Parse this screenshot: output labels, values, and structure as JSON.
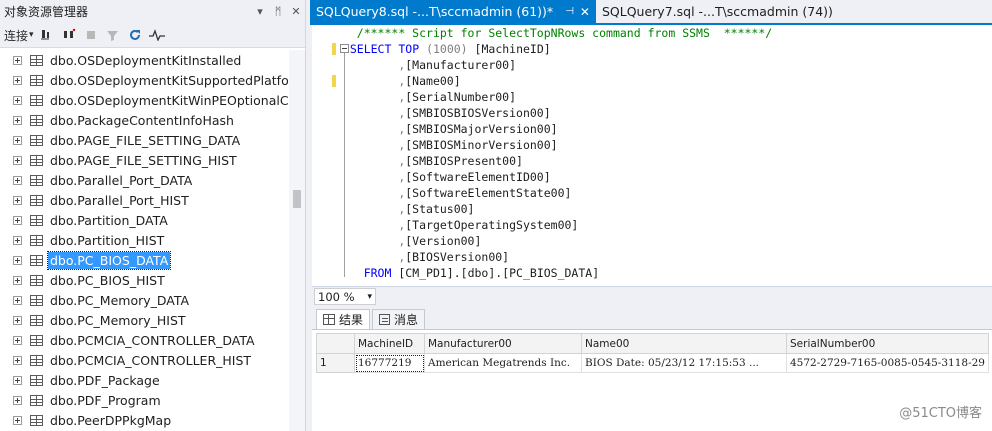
{
  "object_explorer": {
    "title": "对象资源管理器",
    "title_icons": [
      "▾",
      "ᛗ",
      "✕"
    ],
    "toolbar": {
      "connect_label": "连接",
      "connect_arrow": "▾"
    },
    "items": [
      {
        "label": "dbo.OSDeploymentKitInstalled",
        "selected": false
      },
      {
        "label": "dbo.OSDeploymentKitSupportedPlatform",
        "selected": false
      },
      {
        "label": "dbo.OSDeploymentKitWinPEOptionalCor",
        "selected": false
      },
      {
        "label": "dbo.PackageContentInfoHash",
        "selected": false
      },
      {
        "label": "dbo.PAGE_FILE_SETTING_DATA",
        "selected": false
      },
      {
        "label": "dbo.PAGE_FILE_SETTING_HIST",
        "selected": false
      },
      {
        "label": "dbo.Parallel_Port_DATA",
        "selected": false
      },
      {
        "label": "dbo.Parallel_Port_HIST",
        "selected": false
      },
      {
        "label": "dbo.Partition_DATA",
        "selected": false
      },
      {
        "label": "dbo.Partition_HIST",
        "selected": false
      },
      {
        "label": "dbo.PC_BIOS_DATA",
        "selected": true
      },
      {
        "label": "dbo.PC_BIOS_HIST",
        "selected": false
      },
      {
        "label": "dbo.PC_Memory_DATA",
        "selected": false
      },
      {
        "label": "dbo.PC_Memory_HIST",
        "selected": false
      },
      {
        "label": "dbo.PCMCIA_CONTROLLER_DATA",
        "selected": false
      },
      {
        "label": "dbo.PCMCIA_CONTROLLER_HIST",
        "selected": false
      },
      {
        "label": "dbo.PDF_Package",
        "selected": false
      },
      {
        "label": "dbo.PDF_Program",
        "selected": false
      },
      {
        "label": "dbo.PeerDPPkgMap",
        "selected": false
      }
    ]
  },
  "tabs": [
    {
      "label": "SQLQuery8.sql -...T\\sccmadmin (61))*",
      "active": true,
      "pin": "⊣",
      "close": "✕"
    },
    {
      "label": "SQLQuery7.sql -...T\\sccmadmin (74))",
      "active": false
    }
  ],
  "editor": {
    "comment": "/****** Script for SelectTopNRows command from SSMS  ******/",
    "select_kw": "SELECT",
    "top_kw": "TOP",
    "top_value": "(1000)",
    "first_column": "[MachineID]",
    "columns": [
      "[Manufacturer00]",
      "[Name00]",
      "[SerialNumber00]",
      "[SMBIOSBIOSVersion00]",
      "[SMBIOSMajorVersion00]",
      "[SMBIOSMinorVersion00]",
      "[SMBIOSPresent00]",
      "[SoftwareElementID00]",
      "[SoftwareElementState00]",
      "[Status00]",
      "[TargetOperatingSystem00]",
      "[Version00]",
      "[BIOSVersion00]"
    ],
    "from_kw": "FROM",
    "from_table": "[CM_PD1].[dbo].[PC_BIOS_DATA]"
  },
  "zoom": {
    "value": "100 %",
    "arrow": "▾"
  },
  "results": {
    "tabs": [
      {
        "label": "结果",
        "active": true
      },
      {
        "label": "消息",
        "active": false
      }
    ],
    "columns": [
      "MachineID",
      "Manufacturer00",
      "Name00",
      "SerialNumber00"
    ],
    "rows": [
      {
        "num": "1",
        "cells": [
          "16777219",
          "American Megatrends Inc.",
          "BIOS Date: 05/23/12 17:15:53 ...",
          "4572-2729-7165-0085-0545-3118-29"
        ]
      }
    ]
  },
  "watermark": "@51CTO博客"
}
